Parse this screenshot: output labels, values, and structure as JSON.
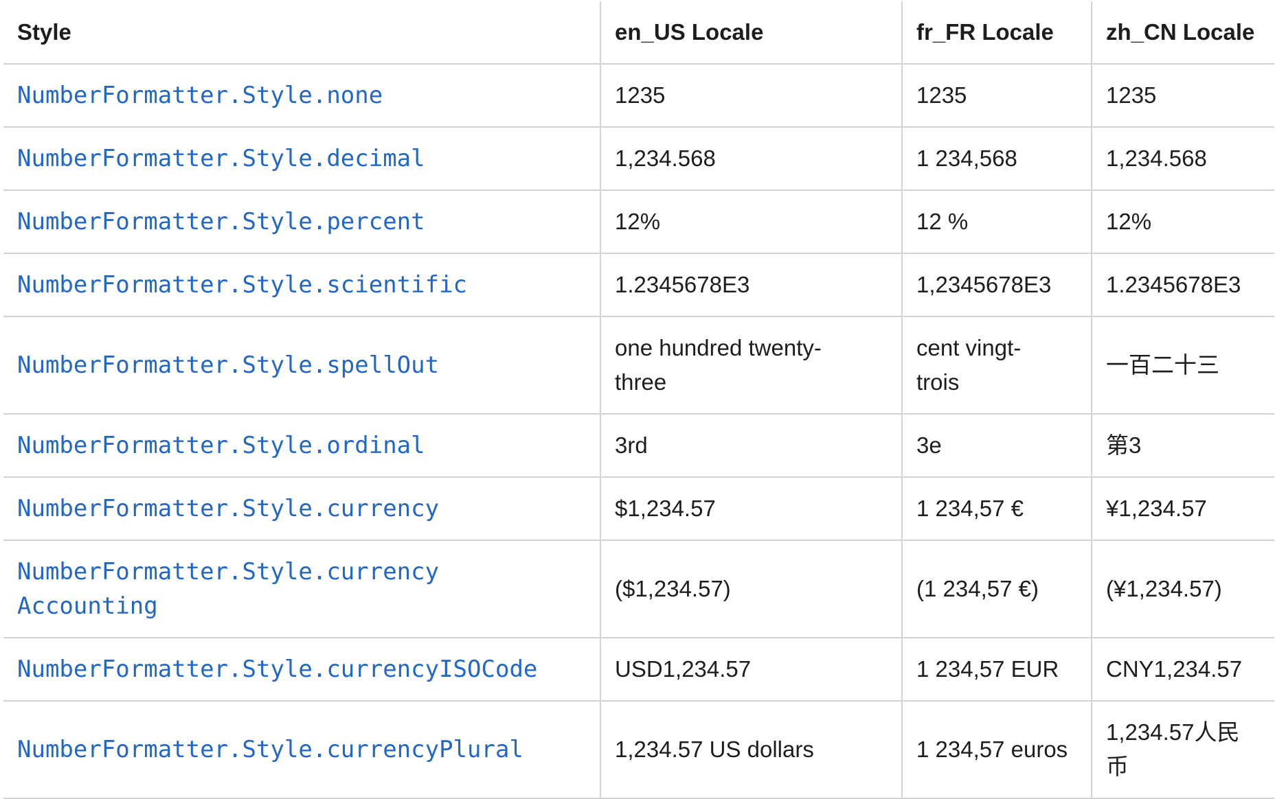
{
  "table": {
    "headers": [
      "Style",
      "en_US Locale",
      "fr_FR Locale",
      "zh_CN Locale"
    ],
    "rows": [
      {
        "style_lines": [
          "NumberFormatter.Style.none"
        ],
        "en_US": [
          "1235"
        ],
        "fr_FR": [
          "1235"
        ],
        "zh_CN": [
          "1235"
        ]
      },
      {
        "style_lines": [
          "NumberFormatter.Style.decimal"
        ],
        "en_US": [
          "1,234.568"
        ],
        "fr_FR": [
          "1 234,568"
        ],
        "zh_CN": [
          "1,234.568"
        ]
      },
      {
        "style_lines": [
          "NumberFormatter.Style.percent"
        ],
        "en_US": [
          "12%"
        ],
        "fr_FR": [
          "12 %"
        ],
        "zh_CN": [
          "12%"
        ]
      },
      {
        "style_lines": [
          "NumberFormatter.Style.scientific"
        ],
        "en_US": [
          "1.2345678E3"
        ],
        "fr_FR": [
          "1,2345678E3"
        ],
        "zh_CN": [
          "1.2345678E3"
        ]
      },
      {
        "style_lines": [
          "NumberFormatter.Style.spellOut"
        ],
        "en_US": [
          "one hundred twenty-",
          "three"
        ],
        "fr_FR": [
          "cent vingt-",
          "trois"
        ],
        "zh_CN": [
          "一百二十三"
        ]
      },
      {
        "style_lines": [
          "NumberFormatter.Style.ordinal"
        ],
        "en_US": [
          "3rd"
        ],
        "fr_FR": [
          "3e"
        ],
        "zh_CN": [
          "第3"
        ]
      },
      {
        "style_lines": [
          "NumberFormatter.Style.currency"
        ],
        "en_US": [
          "$1,234.57"
        ],
        "fr_FR": [
          "1 234,57 €"
        ],
        "zh_CN": [
          "¥1,234.57"
        ]
      },
      {
        "style_lines": [
          "NumberFormatter.Style.currency",
          "Accounting"
        ],
        "en_US": [
          "($1,234.57)"
        ],
        "fr_FR": [
          "(1 234,57 €)"
        ],
        "zh_CN": [
          "(¥1,234.57)"
        ]
      },
      {
        "style_lines": [
          "NumberFormatter.Style.currencyISOCode"
        ],
        "en_US": [
          "USD1,234.57"
        ],
        "fr_FR": [
          "1 234,57 EUR"
        ],
        "zh_CN": [
          "CNY1,234.57"
        ]
      },
      {
        "style_lines": [
          "NumberFormatter.Style.currencyPlural"
        ],
        "en_US": [
          "1,234.57 US dollars"
        ],
        "fr_FR": [
          "1 234,57 euros"
        ],
        "zh_CN": [
          "1,234.57人民",
          "币"
        ]
      }
    ]
  },
  "colors": {
    "link": "#2266c6",
    "text": "#1d1d1f",
    "border": "#d2d2d7"
  }
}
